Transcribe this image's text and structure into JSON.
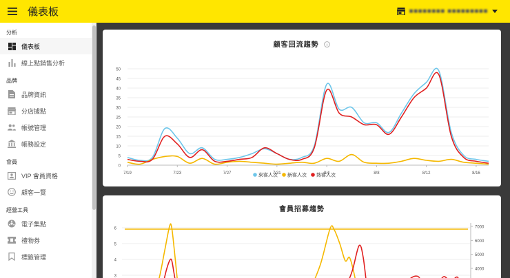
{
  "header": {
    "app_title": "儀表板",
    "store_name": "■■■■■■■■ ■■■■■■■■■"
  },
  "sidebar": {
    "sections": [
      {
        "label": "分析",
        "items": [
          {
            "label": "儀表板",
            "icon": "dashboard-icon",
            "active": true
          },
          {
            "label": "線上點銷售分析",
            "icon": "bar-chart-icon"
          }
        ]
      },
      {
        "label": "品牌",
        "items": [
          {
            "label": "品牌資訊",
            "icon": "document-icon"
          },
          {
            "label": "分店據點",
            "icon": "store-icon"
          },
          {
            "label": "帳號管理",
            "icon": "people-icon"
          },
          {
            "label": "帳務設定",
            "icon": "bank-icon"
          }
        ]
      },
      {
        "label": "會員",
        "items": [
          {
            "label": "VIP 會員資格",
            "icon": "badge-icon"
          },
          {
            "label": "顧客一覽",
            "icon": "smiley-icon"
          }
        ]
      },
      {
        "label": "經營工具",
        "items": [
          {
            "label": "電子集點",
            "icon": "stamp-icon"
          },
          {
            "label": "禮物券",
            "icon": "ticket-icon"
          },
          {
            "label": "標籤管理",
            "icon": "bookmark-icon"
          }
        ]
      }
    ]
  },
  "colors": {
    "accent": "#ffe600",
    "series_total": "#6ec6ea",
    "series_new": "#f5b800",
    "series_return": "#e02020"
  },
  "chart_data": [
    {
      "type": "line",
      "title": "顧客回流趨勢",
      "ylim": [
        0,
        50
      ],
      "yticks": [
        0,
        5,
        10,
        15,
        20,
        25,
        30,
        35,
        40,
        45,
        50
      ],
      "x_ticks": [
        "7/19",
        "7/23",
        "7/27",
        "7/31",
        "8/4",
        "8/8",
        "8/12",
        "8/16"
      ],
      "x_count": 30,
      "series": [
        {
          "name": "來客人次",
          "color": "#6ec6ea",
          "values": [
            4,
            2.5,
            4,
            19,
            14,
            6,
            9,
            3,
            3,
            4,
            6,
            8.5,
            6,
            3,
            4,
            10,
            42,
            29,
            30,
            22,
            22,
            17,
            27,
            37,
            43,
            49,
            17,
            5,
            3,
            2
          ]
        },
        {
          "name": "新客人次",
          "color": "#f5b800",
          "values": [
            1.5,
            0.5,
            3,
            4.5,
            4.5,
            1,
            3.5,
            0.5,
            1.5,
            2,
            1.5,
            1,
            0.5,
            1,
            1.5,
            1,
            3.5,
            2,
            5.5,
            1.5,
            1,
            1,
            2,
            3.5,
            2.5,
            2,
            3,
            1.5,
            1,
            0.5
          ]
        },
        {
          "name": "熟客人次",
          "color": "#e02020",
          "values": [
            3,
            2,
            3,
            15,
            11,
            4,
            8,
            2,
            2,
            3,
            4,
            9,
            6,
            3,
            3,
            9,
            39,
            27,
            25,
            21,
            21,
            16,
            25,
            35,
            40,
            47,
            15,
            4,
            2,
            1
          ]
        }
      ],
      "legend": "bottom"
    },
    {
      "type": "line",
      "title": "會員招募趨勢",
      "y_left_ticks": [
        3,
        4,
        5,
        6
      ],
      "y_right_ticks": [
        4000,
        5000,
        6000,
        7000
      ]
    }
  ]
}
